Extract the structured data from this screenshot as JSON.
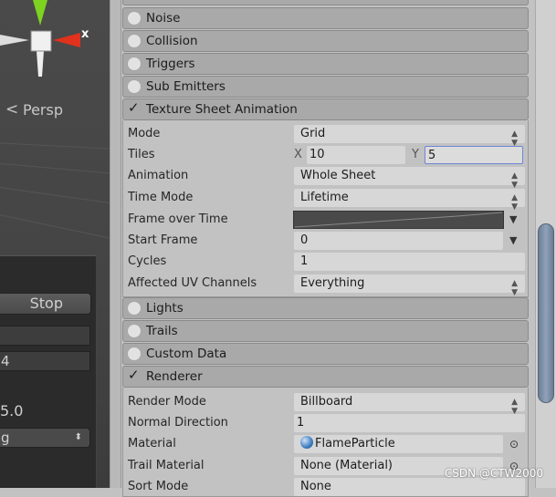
{
  "scene": {
    "axis_label": "x",
    "projection_label": "Persp",
    "projection_icon": "chevron-left-icon"
  },
  "overlay": {
    "stop_label": "Stop",
    "field1": "",
    "field2": "4",
    "value": "5.0",
    "dropdown": "g"
  },
  "modules_top": [
    {
      "label": "Noise",
      "enabled": false
    },
    {
      "label": "Collision",
      "enabled": false
    },
    {
      "label": "Triggers",
      "enabled": false
    },
    {
      "label": "Sub Emitters",
      "enabled": false
    }
  ],
  "texture_sheet": {
    "label": "Texture Sheet Animation",
    "enabled": true,
    "mode": {
      "label": "Mode",
      "value": "Grid"
    },
    "tiles": {
      "label": "Tiles",
      "x_label": "X",
      "x": "10",
      "y_label": "Y",
      "y": "5"
    },
    "animation": {
      "label": "Animation",
      "value": "Whole Sheet"
    },
    "time_mode": {
      "label": "Time Mode",
      "value": "Lifetime"
    },
    "frame_over_time": {
      "label": "Frame over Time"
    },
    "start_frame": {
      "label": "Start Frame",
      "value": "0"
    },
    "cycles": {
      "label": "Cycles",
      "value": "1"
    },
    "uv_channels": {
      "label": "Affected UV Channels",
      "value": "Everything"
    }
  },
  "modules_mid": [
    {
      "label": "Lights",
      "enabled": false
    },
    {
      "label": "Trails",
      "enabled": false
    },
    {
      "label": "Custom Data",
      "enabled": false
    }
  ],
  "renderer": {
    "label": "Renderer",
    "enabled": true,
    "render_mode": {
      "label": "Render Mode",
      "value": "Billboard"
    },
    "normal_direction": {
      "label": "Normal Direction",
      "value": "1"
    },
    "material": {
      "label": "Material",
      "value": "FlameParticle"
    },
    "trail_material": {
      "label": "Trail Material",
      "value": "None (Material)"
    },
    "sort_mode": {
      "label": "Sort Mode",
      "value": "None"
    }
  },
  "watermark": "CSDN @CTW2000",
  "colors": {
    "x_axis": "#e0321c",
    "y_axis": "#7ed321",
    "focus": "#6f86d6",
    "scroll_thumb": "#7f92aa"
  }
}
